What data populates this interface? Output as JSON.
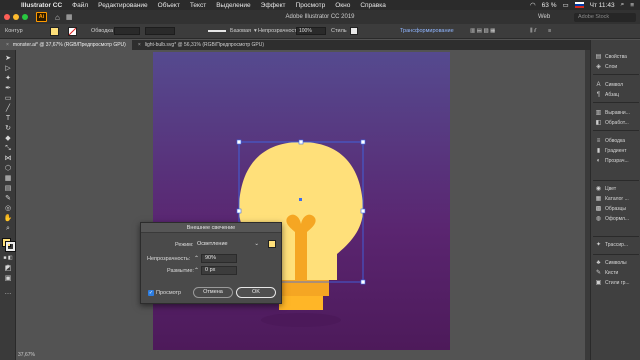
{
  "menubar": {
    "app": "Illustrator CC",
    "items": [
      "Файл",
      "Редактирование",
      "Объект",
      "Текст",
      "Выделение",
      "Эффект",
      "Просмотр",
      "Окно",
      "Справка"
    ],
    "battery": "63 %",
    "clock": "Чт 11:43"
  },
  "appbar": {
    "logo": "Ai",
    "title": "Adobe Illustrator CC 2019",
    "workspace": "Web",
    "search_placeholder": "Adobe Stock"
  },
  "control": {
    "label": "Контур",
    "stroke_label": "Обводка",
    "brush_label": "Базовая",
    "opacity_label": "Непрозрачность",
    "opacity_value": "100%",
    "style_label": "Стиль",
    "transform_label": "Трансформирование"
  },
  "tabs": [
    {
      "label": "monster.ai* @ 37,67% (RGB/Предпросмотр GPU)",
      "active": true
    },
    {
      "label": "light-bulb.svg* @ 56,31% (RGB/Предпросмотр GPU)",
      "active": false
    }
  ],
  "right_panel": [
    {
      "icon": "brushes-icon",
      "label": "Свойства"
    },
    {
      "icon": "layers-icon",
      "label": "Слои"
    },
    {
      "icon": "symbol-icon",
      "label": "Символ"
    },
    {
      "icon": "paragraph-icon",
      "label": "Абзац"
    },
    {
      "icon": "align-icon",
      "label": "Выравни..."
    },
    {
      "icon": "pathfinder-icon",
      "label": "Обработ..."
    },
    {
      "icon": "stroke-icon",
      "label": "Обводка"
    },
    {
      "icon": "gradient-icon",
      "label": "Градиент"
    },
    {
      "icon": "transparency-icon",
      "label": "Прозрач..."
    },
    {
      "icon": "color-icon",
      "label": "Цвет"
    },
    {
      "icon": "catalog-icon",
      "label": "Каталог ..."
    },
    {
      "icon": "swatches-icon",
      "label": "Образцы"
    },
    {
      "icon": "appearance-icon",
      "label": "Оформл..."
    },
    {
      "icon": "trace-icon",
      "label": "Трассир..."
    },
    {
      "icon": "symbols-icon",
      "label": "Символы"
    },
    {
      "icon": "graphic-styles-icon",
      "label": "Стили гр..."
    }
  ],
  "dialog": {
    "title": "Внешнее свечение",
    "mode_label": "Режим:",
    "mode_value": "Осветление",
    "opacity_label": "Непрозрачность:",
    "opacity_value": "90%",
    "blur_label": "Размытие:",
    "blur_value": "0 px",
    "preview_label": "Просмотр",
    "cancel_label": "Отмена",
    "ok_label": "OK",
    "glow_color": "#ffe07a"
  },
  "colors": {
    "fill": "#ffe07a",
    "bulb": "#ffe07a",
    "bulb_base": "#ffbf3f",
    "filament": "#f5a623",
    "selection": "#3d6cf0",
    "ai_orange": "#ff9a00"
  },
  "zoom": "37,67%"
}
